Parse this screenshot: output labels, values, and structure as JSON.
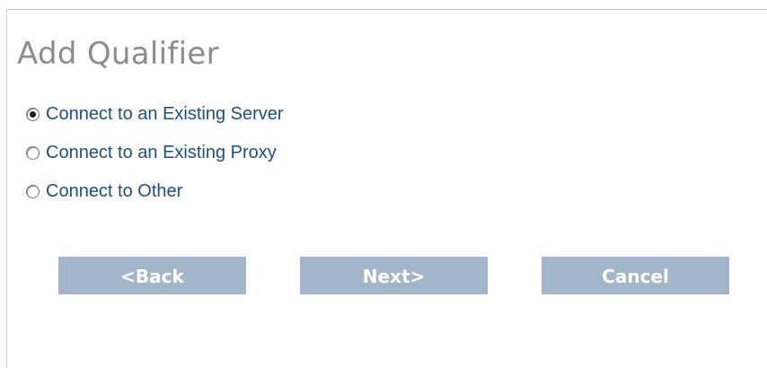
{
  "dialog": {
    "title": "Add Qualifier"
  },
  "options": {
    "selected": "Connect to an Existing Server",
    "items": [
      {
        "label": "Connect to an Existing Server",
        "checked": true
      },
      {
        "label": "Connect to an Existing Proxy",
        "checked": false
      },
      {
        "label": "Connect to Other",
        "checked": false
      }
    ]
  },
  "buttons": {
    "back": "<Back",
    "next": "Next>",
    "cancel": "Cancel"
  },
  "colors": {
    "title": "#8c8c8c",
    "option_label": "#1e4f80",
    "button_bg": "#a3b6c9",
    "button_text": "#ffffff"
  }
}
